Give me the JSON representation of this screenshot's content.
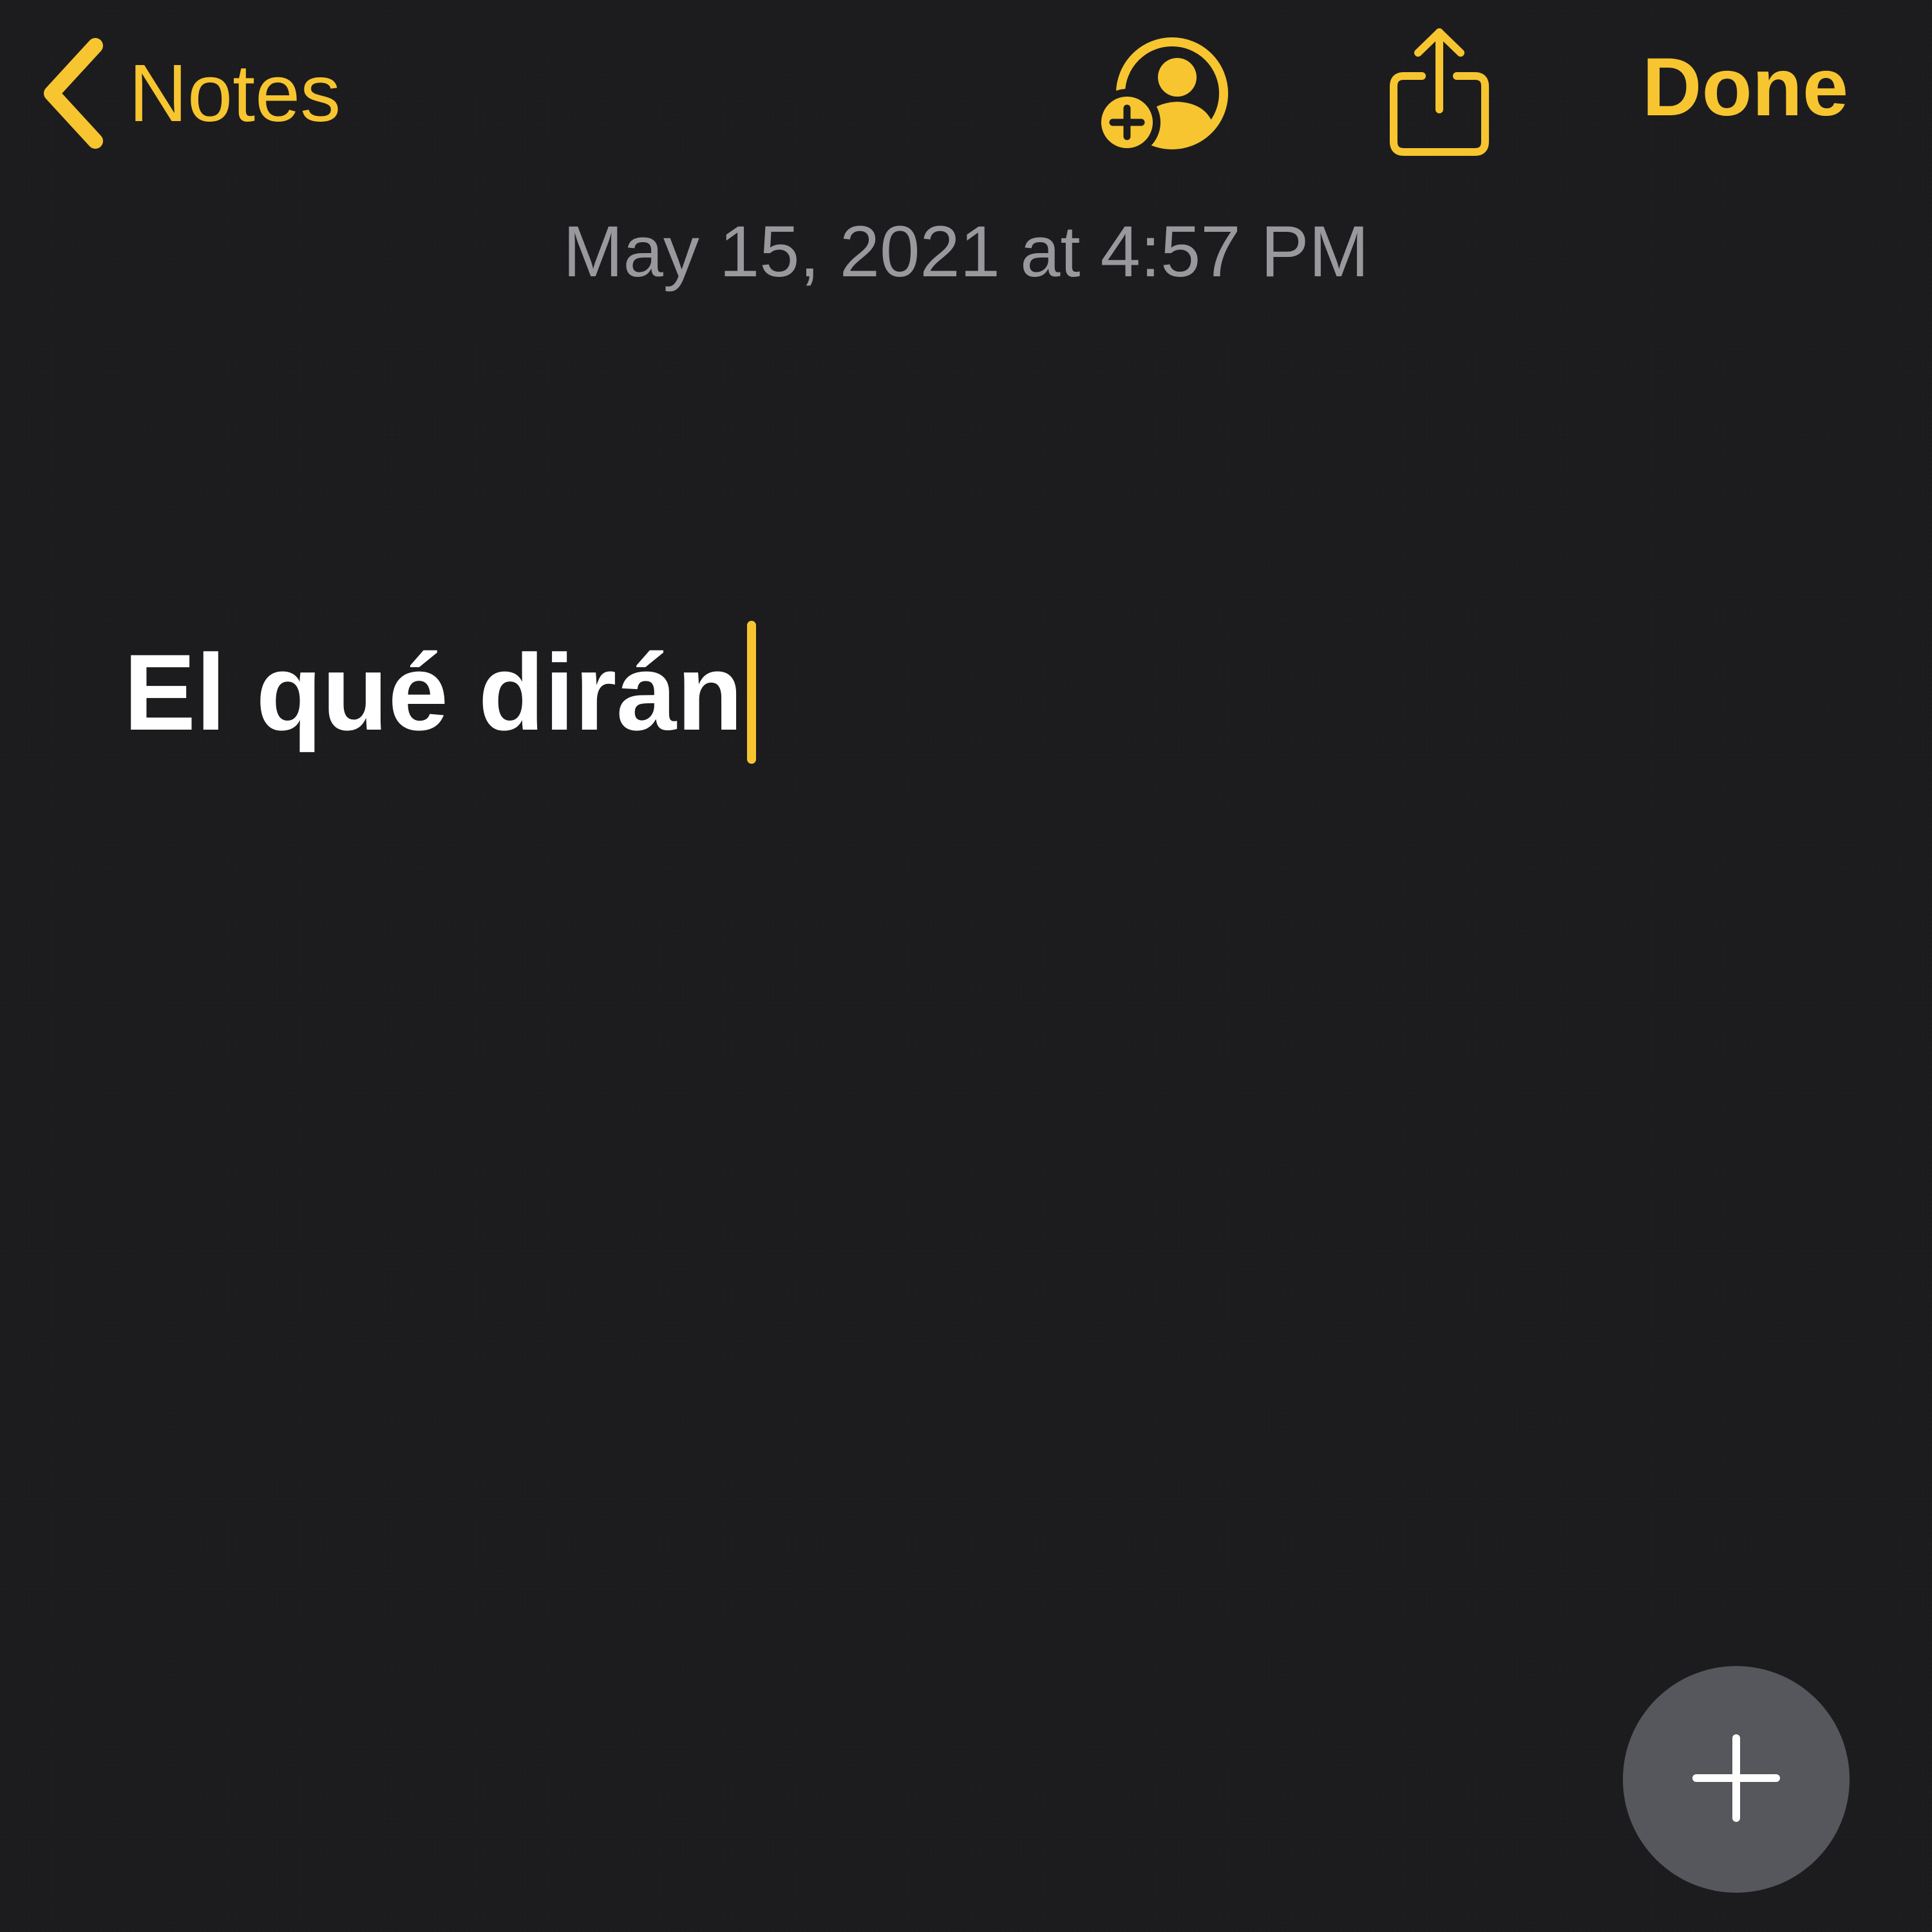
{
  "nav": {
    "back_label": "Notes",
    "done_label": "Done",
    "icons": {
      "back": "chevron-left-icon",
      "add_person": "person-add-icon",
      "share": "share-icon"
    }
  },
  "note": {
    "date": "May 15, 2021 at 4:57 PM",
    "title": "El qué dirán"
  },
  "fab": {
    "icon": "plus-icon"
  },
  "colors": {
    "accent": "#f7c530",
    "background": "#1c1c1e",
    "date_text": "#98989d",
    "fab_background": "#55575c"
  }
}
